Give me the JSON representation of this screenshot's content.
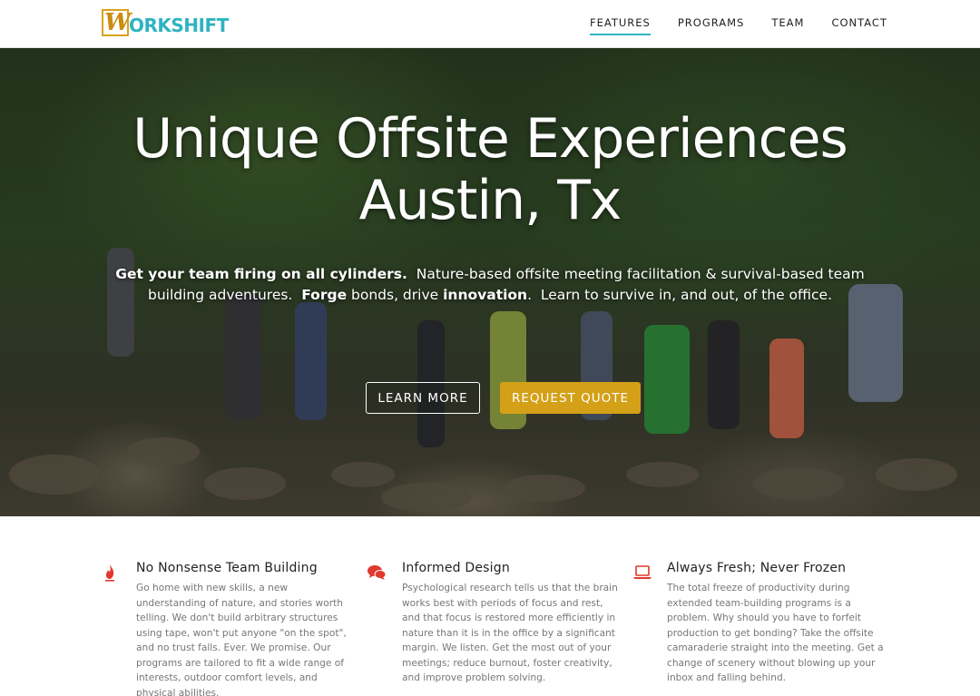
{
  "brand": {
    "logo_letter": "W",
    "logo_text": "ORKSHIFT",
    "colors": {
      "accent": "#2fb3c2",
      "gold": "#d4a017",
      "icon": "#e0392d"
    }
  },
  "nav": {
    "items": [
      {
        "label": "FEATURES",
        "active": true
      },
      {
        "label": "PROGRAMS",
        "active": false
      },
      {
        "label": "TEAM",
        "active": false
      },
      {
        "label": "CONTACT",
        "active": false
      }
    ]
  },
  "hero": {
    "title_line1": "Unique Offsite Experiences",
    "title_line2": "Austin, Tx",
    "sub": {
      "bold1": "Get your team firing on all cylinders.",
      "text1": "  Nature-based offsite meeting facilitation & survival-based team building adventures.  ",
      "bold2": "Forge",
      "text2": " bonds, drive ",
      "bold3": "innovation",
      "text3": ".  Learn to survive in, and out, of the office."
    },
    "buttons": {
      "learn_more": "LEARN MORE",
      "request_quote": "REQUEST QUOTE"
    }
  },
  "features": [
    {
      "icon": "fire-icon",
      "title": "No Nonsense Team Building",
      "body": "Go home with new skills, a new understanding of nature, and stories worth telling. We don't build arbitrary structures using tape, won't put anyone \"on the spot\", and no trust falls. Ever. We promise. Our programs are tailored to fit a wide range of interests, outdoor comfort levels, and physical abilities."
    },
    {
      "icon": "chat-bubbles-icon",
      "title": "Informed Design",
      "body": "Psychological research tells us that the brain works best with periods of focus and rest, and that focus is restored more efficiently in nature than it is in the office by a significant margin. We listen. Get the most out of your meetings; reduce burnout, foster creativity, and improve problem solving."
    },
    {
      "icon": "laptop-icon",
      "title": "Always Fresh; Never Frozen",
      "body": "The total freeze of productivity during extended team-building programs is a problem. Why should you have to forfeit production to get bonding? Take the offsite camaraderie straight into the meeting. Get a change of scenery without blowing up your inbox and falling behind."
    }
  ]
}
